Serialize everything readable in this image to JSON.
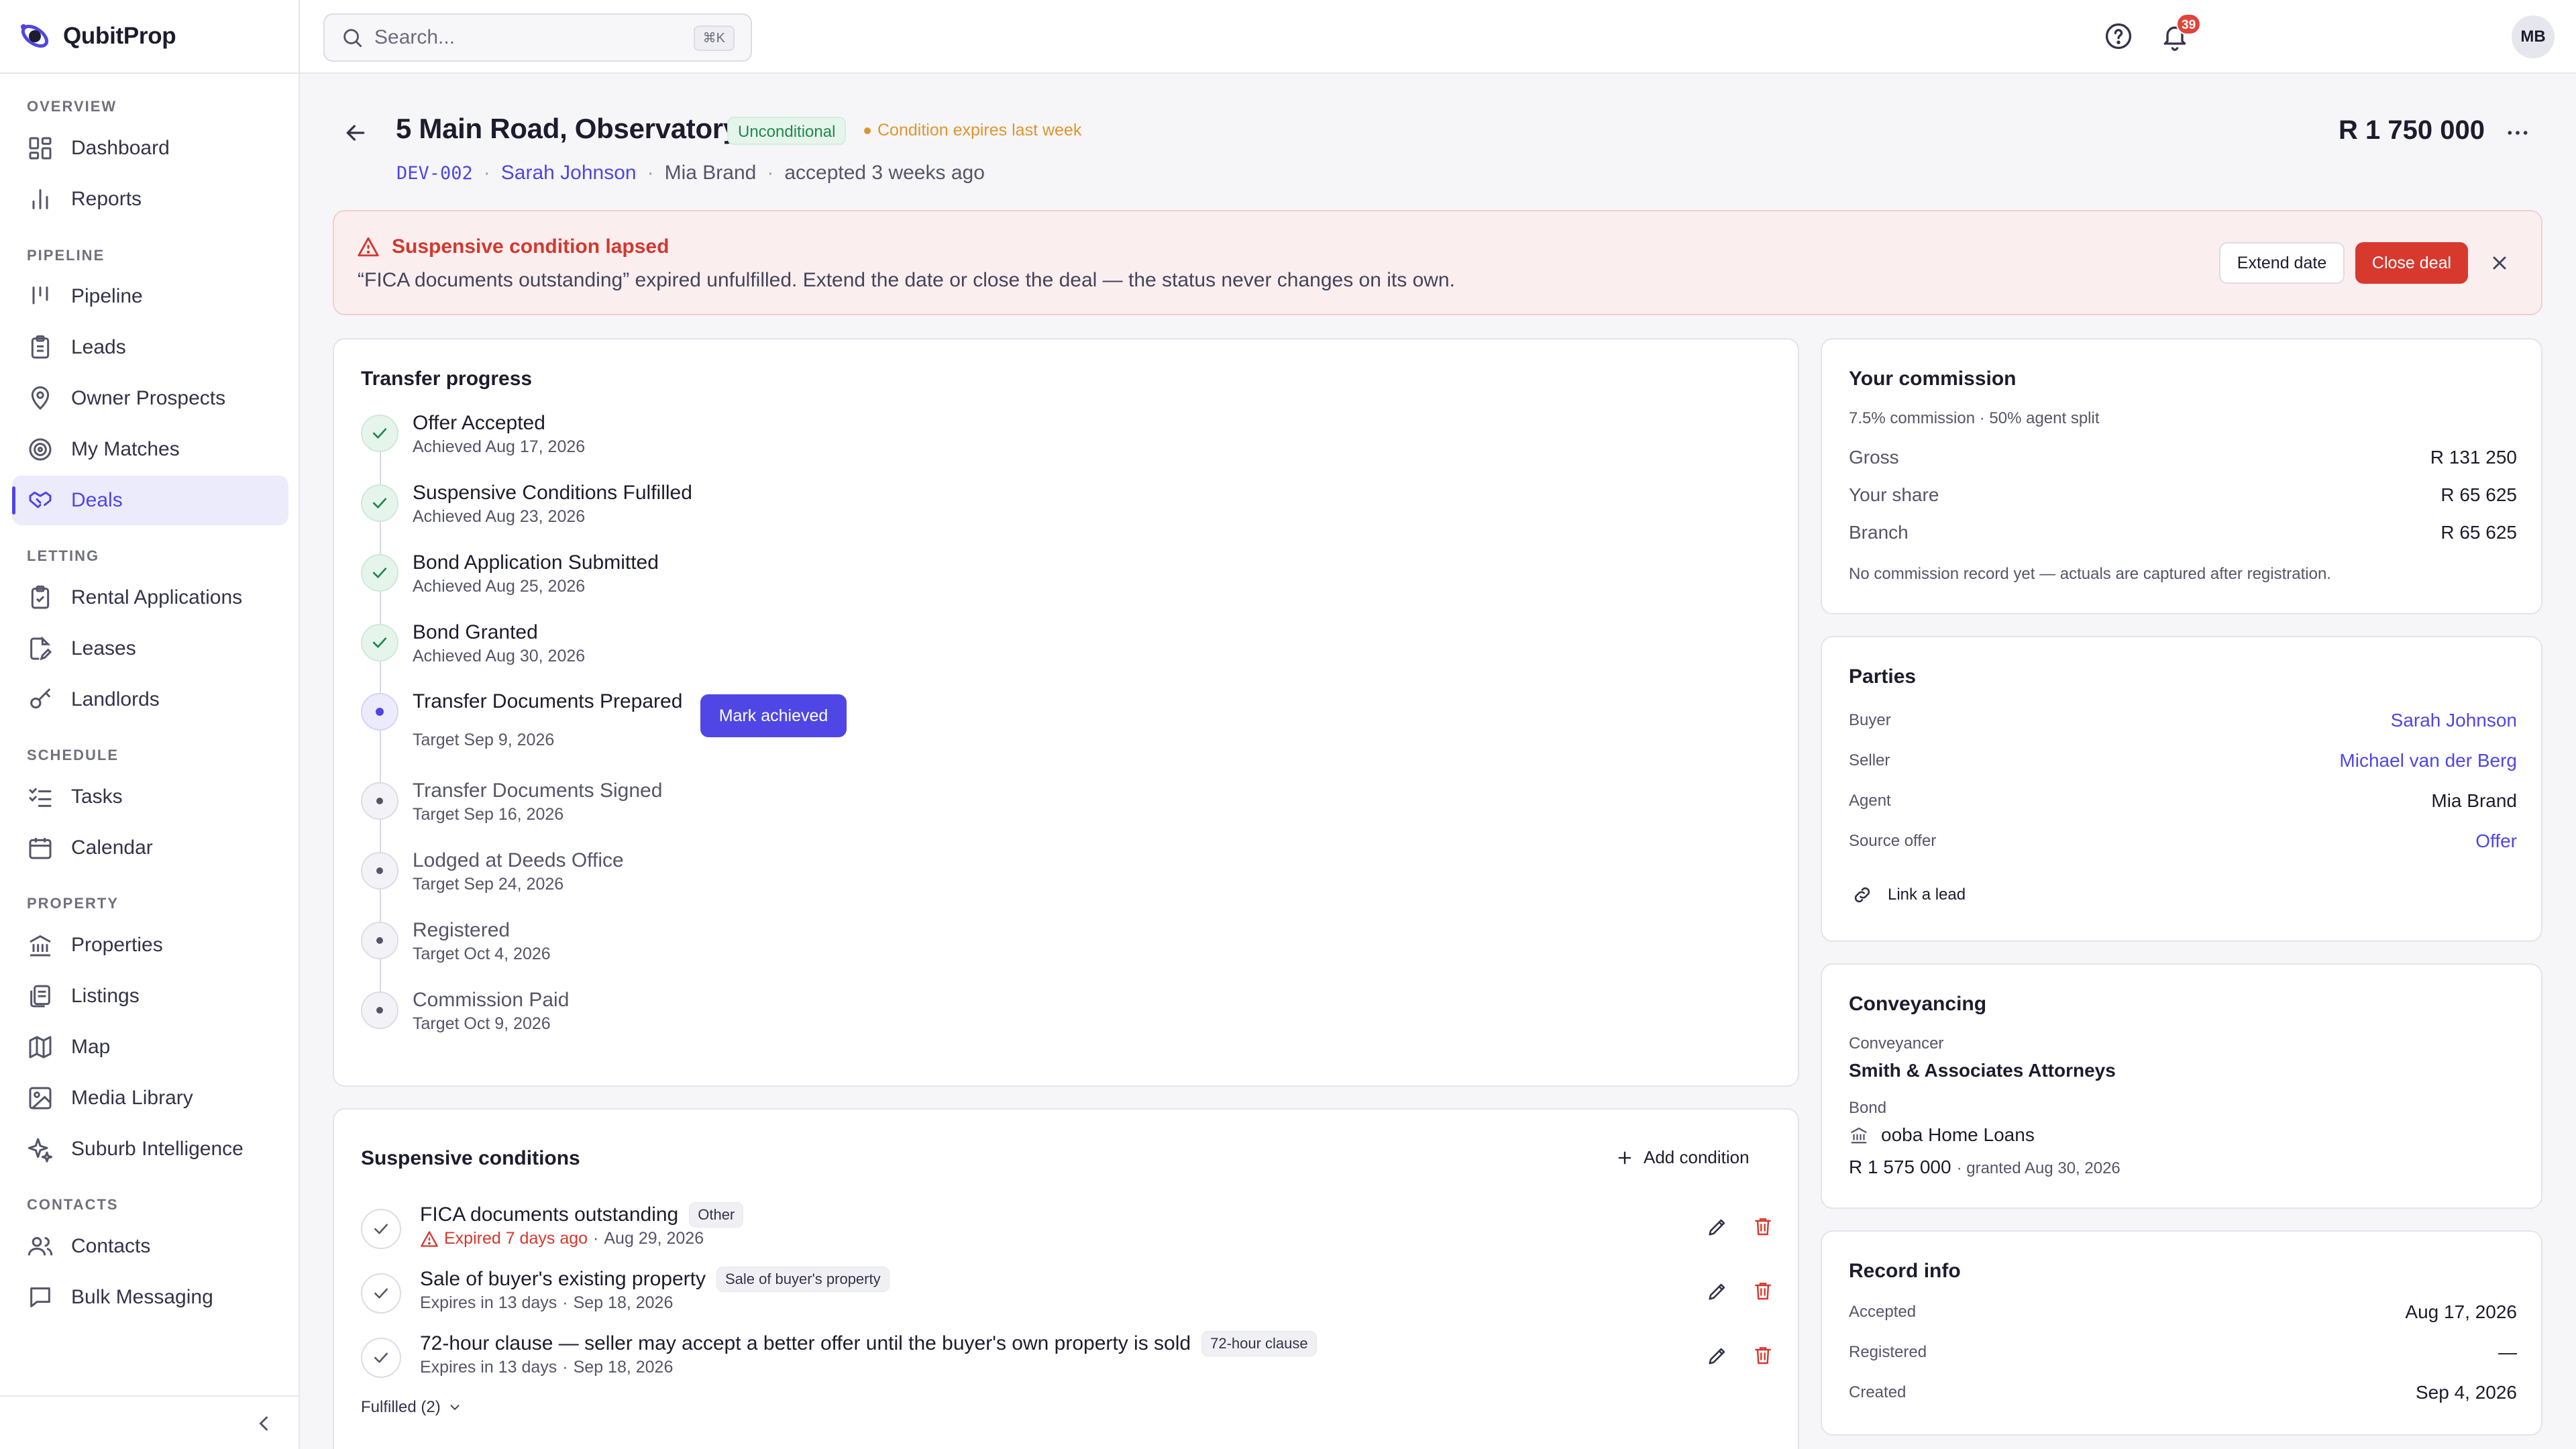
{
  "app": {
    "name": "QubitProp"
  },
  "sidebar": {
    "sections": {
      "overview": "OVERVIEW",
      "pipeline": "PIPELINE",
      "letting": "LETTING",
      "schedule": "SCHEDULE",
      "property": "PROPERTY",
      "contacts": "CONTACTS"
    },
    "items": {
      "dashboard": "Dashboard",
      "reports": "Reports",
      "pipeline": "Pipeline",
      "leads": "Leads",
      "owner_prospects": "Owner Prospects",
      "my_matches": "My Matches",
      "deals": "Deals",
      "rental_applications": "Rental Applications",
      "leases": "Leases",
      "landlords": "Landlords",
      "tasks": "Tasks",
      "calendar": "Calendar",
      "properties": "Properties",
      "listings": "Listings",
      "map": "Map",
      "media_library": "Media Library",
      "suburb_intelligence": "Suburb Intelligence",
      "contacts": "Contacts",
      "bulk_messaging": "Bulk Messaging"
    },
    "active": "deals"
  },
  "topbar": {
    "search_placeholder": "Search...",
    "search_shortcut": "⌘K",
    "notification_count": "39",
    "avatar_initials": "MB"
  },
  "deal": {
    "title": "5 Main Road, Observatory",
    "status": "Unconditional",
    "expiry_note": "Condition expires last week",
    "code": "DEV-002",
    "buyer": "Sarah Johnson",
    "agent": "Mia Brand",
    "accepted": "accepted 3 weeks ago",
    "price": "R 1 750 000"
  },
  "alert": {
    "title": "Suspensive condition lapsed",
    "body": "“FICA documents outstanding” expired unfulfilled. Extend the date or close the deal — the status never changes on its own.",
    "extend_label": "Extend date",
    "close_label": "Close deal"
  },
  "progress": {
    "title": "Transfer progress",
    "mark_label": "Mark achieved",
    "steps": [
      {
        "label": "Offer Accepted",
        "sub": "Achieved Aug 17, 2026",
        "state": "done"
      },
      {
        "label": "Suspensive Conditions Fulfilled",
        "sub": "Achieved Aug 23, 2026",
        "state": "done"
      },
      {
        "label": "Bond Application Submitted",
        "sub": "Achieved Aug 25, 2026",
        "state": "done"
      },
      {
        "label": "Bond Granted",
        "sub": "Achieved Aug 30, 2026",
        "state": "done"
      },
      {
        "label": "Transfer Documents Prepared",
        "sub": "Target Sep 9, 2026",
        "state": "current"
      },
      {
        "label": "Transfer Documents Signed",
        "sub": "Target Sep 16, 2026",
        "state": "pending"
      },
      {
        "label": "Lodged at Deeds Office",
        "sub": "Target Sep 24, 2026",
        "state": "pending"
      },
      {
        "label": "Registered",
        "sub": "Target Oct 4, 2026",
        "state": "pending"
      },
      {
        "label": "Commission Paid",
        "sub": "Target Oct 9, 2026",
        "state": "pending"
      }
    ]
  },
  "conditions": {
    "title": "Suspensive conditions",
    "add_label": "Add condition",
    "fulfilled_label": "Fulfilled (2)",
    "items": [
      {
        "title": "FICA documents outstanding",
        "tag": "Other",
        "status": "Expired 7 days ago",
        "date": "Aug 29, 2026",
        "expired": true
      },
      {
        "title": "Sale of buyer's existing property",
        "tag": "Sale of buyer's property",
        "status": "Expires in 13 days",
        "date": "Sep 18, 2026",
        "expired": false
      },
      {
        "title": "72-hour clause — seller may accept a better offer until the buyer's own property is sold",
        "tag": "72-hour clause",
        "status": "Expires in 13 days",
        "date": "Sep 18, 2026",
        "expired": false
      }
    ]
  },
  "commission": {
    "title": "Your commission",
    "subtitle": "7.5% commission · 50% agent split",
    "gross_label": "Gross",
    "gross": "R 131 250",
    "share_label": "Your share",
    "share": "R 65 625",
    "branch_label": "Branch",
    "branch": "R 65 625",
    "note": "No commission record yet — actuals are captured after registration."
  },
  "parties": {
    "title": "Parties",
    "buyer_label": "Buyer",
    "buyer": "Sarah Johnson",
    "seller_label": "Seller",
    "seller": "Michael van der Berg",
    "agent_label": "Agent",
    "agent": "Mia Brand",
    "source_label": "Source offer",
    "source": "Offer",
    "link_lead": "Link a lead"
  },
  "conveyancing": {
    "title": "Conveyancing",
    "conveyancer_label": "Conveyancer",
    "conveyancer": "Smith & Associates Attorneys",
    "bond_label": "Bond",
    "bond_bank": "ooba Home Loans",
    "bond_amount": "R 1 575 000",
    "bond_granted": "· granted Aug 30, 2026"
  },
  "record": {
    "title": "Record info",
    "accepted_label": "Accepted",
    "accepted": "Aug 17, 2026",
    "registered_label": "Registered",
    "registered": "—",
    "created_label": "Created",
    "created": "Sep 4, 2026"
  }
}
